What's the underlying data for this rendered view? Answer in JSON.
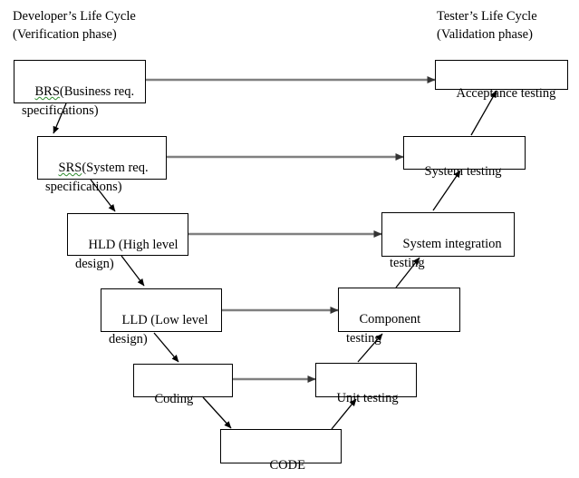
{
  "diagram": {
    "title": "V-Model software development life cycle",
    "headings": {
      "left": "Developer’s Life Cycle\n(Verification phase)",
      "right": "Tester’s Life Cycle\n(Validation phase)"
    },
    "colors": {
      "box_border": "#000000",
      "box_fill": "#ffffff",
      "text": "#000000",
      "horizontal_arrow": "#808080",
      "diagonal_arrow": "#000000",
      "spellcheck_underline": "#2e8b2e"
    },
    "nodes": [
      {
        "id": "brs",
        "label": "BRS(Business req.\nspecifications)",
        "abbrev": "BRS",
        "rest": "(Business req.\nspecifications)",
        "side": "left",
        "misspelled": true
      },
      {
        "id": "srs",
        "label": "SRS(System req.\nspecifications)",
        "abbrev": "SRS",
        "rest": "(System req.\nspecifications)",
        "side": "left",
        "misspelled": true
      },
      {
        "id": "hld",
        "label": "HLD (High level\ndesign)",
        "side": "left",
        "misspelled": false
      },
      {
        "id": "lld",
        "label": "LLD (Low level\ndesign)",
        "side": "left",
        "misspelled": false
      },
      {
        "id": "coding",
        "label": "Coding",
        "side": "left",
        "misspelled": false
      },
      {
        "id": "code",
        "label": "CODE",
        "side": "bottom",
        "misspelled": false
      },
      {
        "id": "unit-testing",
        "label": "Unit testing",
        "side": "right",
        "misspelled": false
      },
      {
        "id": "component-testing",
        "label": "Component\ntesting",
        "side": "right",
        "misspelled": false
      },
      {
        "id": "system-integration-testing",
        "label": "System integration\ntesting",
        "side": "right",
        "misspelled": false
      },
      {
        "id": "system-testing",
        "label": "System testing",
        "side": "right",
        "misspelled": false
      },
      {
        "id": "acceptance-testing",
        "label": "Acceptance testing",
        "side": "right",
        "misspelled": false
      }
    ],
    "connections": [
      {
        "from": "brs",
        "to": "acceptance-testing",
        "kind": "horizontal"
      },
      {
        "from": "srs",
        "to": "system-testing",
        "kind": "horizontal"
      },
      {
        "from": "hld",
        "to": "system-integration-testing",
        "kind": "horizontal"
      },
      {
        "from": "lld",
        "to": "component-testing",
        "kind": "horizontal"
      },
      {
        "from": "coding",
        "to": "unit-testing",
        "kind": "horizontal"
      },
      {
        "from": "brs",
        "to": "srs",
        "kind": "diagonal-down"
      },
      {
        "from": "srs",
        "to": "hld",
        "kind": "diagonal-down"
      },
      {
        "from": "hld",
        "to": "lld",
        "kind": "diagonal-down"
      },
      {
        "from": "lld",
        "to": "coding",
        "kind": "diagonal-down"
      },
      {
        "from": "coding",
        "to": "code",
        "kind": "diagonal-down"
      },
      {
        "from": "code",
        "to": "unit-testing",
        "kind": "diagonal-up"
      },
      {
        "from": "unit-testing",
        "to": "component-testing",
        "kind": "diagonal-up"
      },
      {
        "from": "component-testing",
        "to": "system-integration-testing",
        "kind": "diagonal-up"
      },
      {
        "from": "system-integration-testing",
        "to": "system-testing",
        "kind": "diagonal-up"
      },
      {
        "from": "system-testing",
        "to": "acceptance-testing",
        "kind": "diagonal-up"
      }
    ]
  }
}
